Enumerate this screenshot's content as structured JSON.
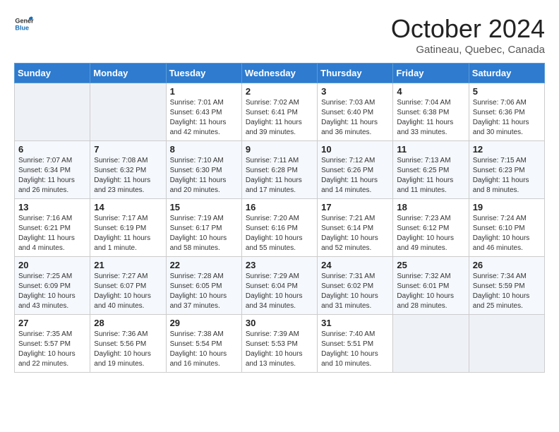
{
  "logo": {
    "text_general": "General",
    "text_blue": "Blue"
  },
  "title": "October 2024",
  "subtitle": "Gatineau, Quebec, Canada",
  "header_days": [
    "Sunday",
    "Monday",
    "Tuesday",
    "Wednesday",
    "Thursday",
    "Friday",
    "Saturday"
  ],
  "weeks": [
    [
      {
        "day": "",
        "sunrise": "",
        "sunset": "",
        "daylight": "",
        "empty": true
      },
      {
        "day": "",
        "sunrise": "",
        "sunset": "",
        "daylight": "",
        "empty": true
      },
      {
        "day": "1",
        "sunrise": "Sunrise: 7:01 AM",
        "sunset": "Sunset: 6:43 PM",
        "daylight": "Daylight: 11 hours and 42 minutes.",
        "empty": false
      },
      {
        "day": "2",
        "sunrise": "Sunrise: 7:02 AM",
        "sunset": "Sunset: 6:41 PM",
        "daylight": "Daylight: 11 hours and 39 minutes.",
        "empty": false
      },
      {
        "day": "3",
        "sunrise": "Sunrise: 7:03 AM",
        "sunset": "Sunset: 6:40 PM",
        "daylight": "Daylight: 11 hours and 36 minutes.",
        "empty": false
      },
      {
        "day": "4",
        "sunrise": "Sunrise: 7:04 AM",
        "sunset": "Sunset: 6:38 PM",
        "daylight": "Daylight: 11 hours and 33 minutes.",
        "empty": false
      },
      {
        "day": "5",
        "sunrise": "Sunrise: 7:06 AM",
        "sunset": "Sunset: 6:36 PM",
        "daylight": "Daylight: 11 hours and 30 minutes.",
        "empty": false
      }
    ],
    [
      {
        "day": "6",
        "sunrise": "Sunrise: 7:07 AM",
        "sunset": "Sunset: 6:34 PM",
        "daylight": "Daylight: 11 hours and 26 minutes.",
        "empty": false
      },
      {
        "day": "7",
        "sunrise": "Sunrise: 7:08 AM",
        "sunset": "Sunset: 6:32 PM",
        "daylight": "Daylight: 11 hours and 23 minutes.",
        "empty": false
      },
      {
        "day": "8",
        "sunrise": "Sunrise: 7:10 AM",
        "sunset": "Sunset: 6:30 PM",
        "daylight": "Daylight: 11 hours and 20 minutes.",
        "empty": false
      },
      {
        "day": "9",
        "sunrise": "Sunrise: 7:11 AM",
        "sunset": "Sunset: 6:28 PM",
        "daylight": "Daylight: 11 hours and 17 minutes.",
        "empty": false
      },
      {
        "day": "10",
        "sunrise": "Sunrise: 7:12 AM",
        "sunset": "Sunset: 6:26 PM",
        "daylight": "Daylight: 11 hours and 14 minutes.",
        "empty": false
      },
      {
        "day": "11",
        "sunrise": "Sunrise: 7:13 AM",
        "sunset": "Sunset: 6:25 PM",
        "daylight": "Daylight: 11 hours and 11 minutes.",
        "empty": false
      },
      {
        "day": "12",
        "sunrise": "Sunrise: 7:15 AM",
        "sunset": "Sunset: 6:23 PM",
        "daylight": "Daylight: 11 hours and 8 minutes.",
        "empty": false
      }
    ],
    [
      {
        "day": "13",
        "sunrise": "Sunrise: 7:16 AM",
        "sunset": "Sunset: 6:21 PM",
        "daylight": "Daylight: 11 hours and 4 minutes.",
        "empty": false
      },
      {
        "day": "14",
        "sunrise": "Sunrise: 7:17 AM",
        "sunset": "Sunset: 6:19 PM",
        "daylight": "Daylight: 11 hours and 1 minute.",
        "empty": false
      },
      {
        "day": "15",
        "sunrise": "Sunrise: 7:19 AM",
        "sunset": "Sunset: 6:17 PM",
        "daylight": "Daylight: 10 hours and 58 minutes.",
        "empty": false
      },
      {
        "day": "16",
        "sunrise": "Sunrise: 7:20 AM",
        "sunset": "Sunset: 6:16 PM",
        "daylight": "Daylight: 10 hours and 55 minutes.",
        "empty": false
      },
      {
        "day": "17",
        "sunrise": "Sunrise: 7:21 AM",
        "sunset": "Sunset: 6:14 PM",
        "daylight": "Daylight: 10 hours and 52 minutes.",
        "empty": false
      },
      {
        "day": "18",
        "sunrise": "Sunrise: 7:23 AM",
        "sunset": "Sunset: 6:12 PM",
        "daylight": "Daylight: 10 hours and 49 minutes.",
        "empty": false
      },
      {
        "day": "19",
        "sunrise": "Sunrise: 7:24 AM",
        "sunset": "Sunset: 6:10 PM",
        "daylight": "Daylight: 10 hours and 46 minutes.",
        "empty": false
      }
    ],
    [
      {
        "day": "20",
        "sunrise": "Sunrise: 7:25 AM",
        "sunset": "Sunset: 6:09 PM",
        "daylight": "Daylight: 10 hours and 43 minutes.",
        "empty": false
      },
      {
        "day": "21",
        "sunrise": "Sunrise: 7:27 AM",
        "sunset": "Sunset: 6:07 PM",
        "daylight": "Daylight: 10 hours and 40 minutes.",
        "empty": false
      },
      {
        "day": "22",
        "sunrise": "Sunrise: 7:28 AM",
        "sunset": "Sunset: 6:05 PM",
        "daylight": "Daylight: 10 hours and 37 minutes.",
        "empty": false
      },
      {
        "day": "23",
        "sunrise": "Sunrise: 7:29 AM",
        "sunset": "Sunset: 6:04 PM",
        "daylight": "Daylight: 10 hours and 34 minutes.",
        "empty": false
      },
      {
        "day": "24",
        "sunrise": "Sunrise: 7:31 AM",
        "sunset": "Sunset: 6:02 PM",
        "daylight": "Daylight: 10 hours and 31 minutes.",
        "empty": false
      },
      {
        "day": "25",
        "sunrise": "Sunrise: 7:32 AM",
        "sunset": "Sunset: 6:01 PM",
        "daylight": "Daylight: 10 hours and 28 minutes.",
        "empty": false
      },
      {
        "day": "26",
        "sunrise": "Sunrise: 7:34 AM",
        "sunset": "Sunset: 5:59 PM",
        "daylight": "Daylight: 10 hours and 25 minutes.",
        "empty": false
      }
    ],
    [
      {
        "day": "27",
        "sunrise": "Sunrise: 7:35 AM",
        "sunset": "Sunset: 5:57 PM",
        "daylight": "Daylight: 10 hours and 22 minutes.",
        "empty": false
      },
      {
        "day": "28",
        "sunrise": "Sunrise: 7:36 AM",
        "sunset": "Sunset: 5:56 PM",
        "daylight": "Daylight: 10 hours and 19 minutes.",
        "empty": false
      },
      {
        "day": "29",
        "sunrise": "Sunrise: 7:38 AM",
        "sunset": "Sunset: 5:54 PM",
        "daylight": "Daylight: 10 hours and 16 minutes.",
        "empty": false
      },
      {
        "day": "30",
        "sunrise": "Sunrise: 7:39 AM",
        "sunset": "Sunset: 5:53 PM",
        "daylight": "Daylight: 10 hours and 13 minutes.",
        "empty": false
      },
      {
        "day": "31",
        "sunrise": "Sunrise: 7:40 AM",
        "sunset": "Sunset: 5:51 PM",
        "daylight": "Daylight: 10 hours and 10 minutes.",
        "empty": false
      },
      {
        "day": "",
        "sunrise": "",
        "sunset": "",
        "daylight": "",
        "empty": true
      },
      {
        "day": "",
        "sunrise": "",
        "sunset": "",
        "daylight": "",
        "empty": true
      }
    ]
  ]
}
